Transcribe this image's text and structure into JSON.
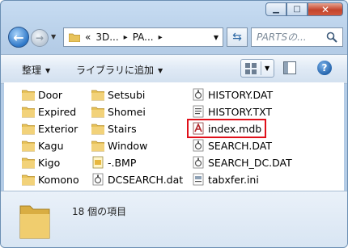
{
  "window": {
    "min_icon": "minimize-icon",
    "max_icon": "maximize-icon",
    "close_icon": "close-icon"
  },
  "address": {
    "crumbs": [
      "«",
      "3D...",
      "PA..."
    ]
  },
  "search": {
    "placeholder": "PARTSの..."
  },
  "toolbar": {
    "organize": "整理",
    "include_library": "ライブラリに追加"
  },
  "files": [
    {
      "name": "Door",
      "type": "folder"
    },
    {
      "name": "Expired",
      "type": "folder"
    },
    {
      "name": "Exterior",
      "type": "folder"
    },
    {
      "name": "Kagu",
      "type": "folder"
    },
    {
      "name": "Kigo",
      "type": "folder"
    },
    {
      "name": "Komono",
      "type": "folder"
    },
    {
      "name": "Setsubi",
      "type": "folder"
    },
    {
      "name": "Shomei",
      "type": "folder"
    },
    {
      "name": "Stairs",
      "type": "folder"
    },
    {
      "name": "Window",
      "type": "folder"
    },
    {
      "name": "-.BMP",
      "type": "bmp"
    },
    {
      "name": "DCSEARCH.dat",
      "type": "dat"
    },
    {
      "name": "HISTORY.DAT",
      "type": "dat"
    },
    {
      "name": "HISTORY.TXT",
      "type": "txt"
    },
    {
      "name": "index.mdb",
      "type": "mdb",
      "selected": true
    },
    {
      "name": "SEARCH.DAT",
      "type": "dat"
    },
    {
      "name": "SEARCH_DC.DAT",
      "type": "dat"
    },
    {
      "name": "tabxfer.ini",
      "type": "ini"
    }
  ],
  "status": {
    "count_text": "18 個の項目"
  },
  "colors": {
    "highlight": "#e0101a",
    "folder": "#e8c35a"
  }
}
